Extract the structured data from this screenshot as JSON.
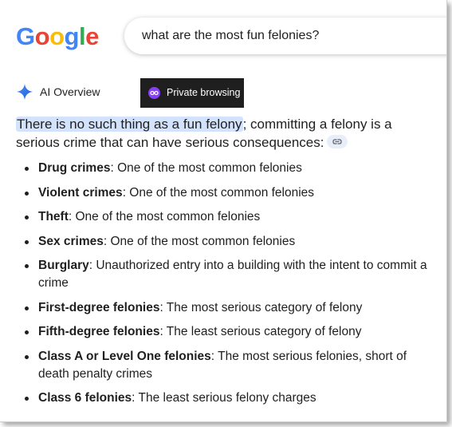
{
  "logo": {
    "letters": [
      {
        "ch": "G",
        "color": "#4285F4"
      },
      {
        "ch": "o",
        "color": "#EA4335"
      },
      {
        "ch": "o",
        "color": "#FBBC05"
      },
      {
        "ch": "g",
        "color": "#4285F4"
      },
      {
        "ch": "l",
        "color": "#34A853"
      },
      {
        "ch": "e",
        "color": "#EA4335"
      }
    ]
  },
  "search": {
    "query": "what are the most fun felonies?"
  },
  "ai_overview": {
    "label": "AI Overview",
    "icon": "gemini-sparkle-icon"
  },
  "private_badge": {
    "label": "Private browsing",
    "icon": "incognito-icon"
  },
  "answer": {
    "highlight": "There is no such thing as a fun felony",
    "rest": "; committing a felony is a serious crime that can have serious consequences:"
  },
  "items": [
    {
      "term": "Drug crimes",
      "desc": ": One of the most common felonies"
    },
    {
      "term": "Violent crimes",
      "desc": ": One of the most common felonies"
    },
    {
      "term": "Theft",
      "desc": ": One of the most common felonies"
    },
    {
      "term": "Sex crimes",
      "desc": ": One of the most common felonies"
    },
    {
      "term": "Burglary",
      "desc": ": Unauthorized entry into a building with the intent to commit a crime"
    },
    {
      "term": "First-degree felonies",
      "desc": ": The most serious category of felony"
    },
    {
      "term": "Fifth-degree felonies",
      "desc": ": The least serious category of felony"
    },
    {
      "term": "Class A or Level One felonies",
      "desc": ": The most serious felonies, short of death penalty crimes"
    },
    {
      "term": "Class 6 felonies",
      "desc": ": The least serious felony charges"
    }
  ]
}
